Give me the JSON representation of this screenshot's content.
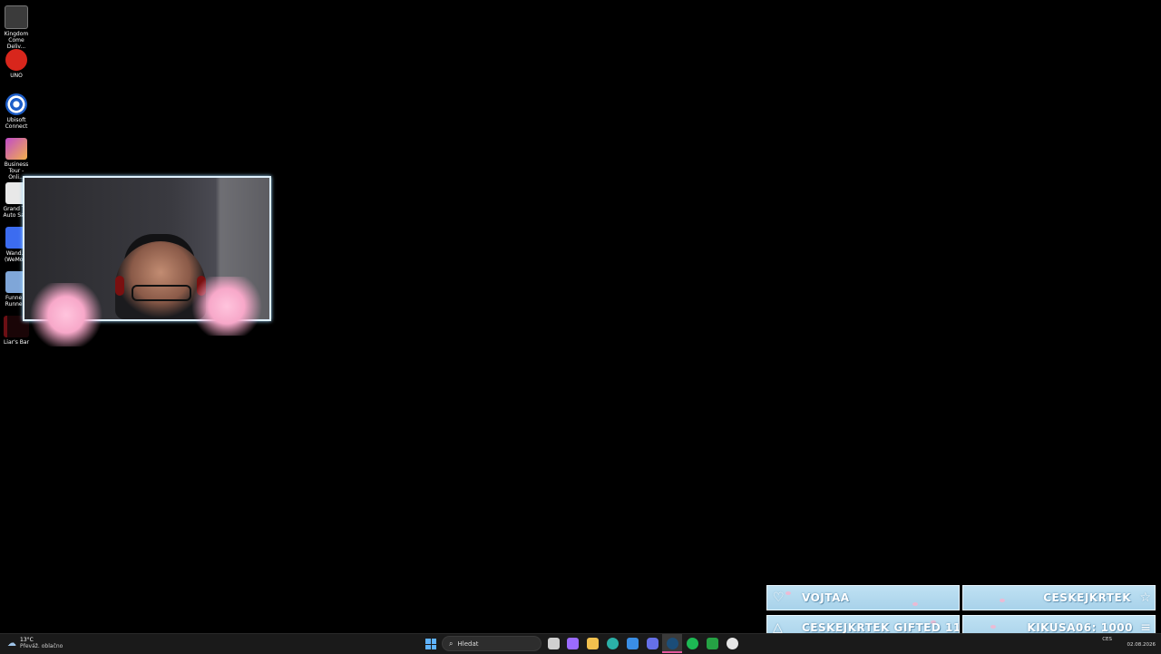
{
  "desktop_icons": [
    {
      "label": "Kingdom Come Deliv...",
      "icon": "kingdom-come-icon",
      "color": "#3b3b3b"
    },
    {
      "label": "UNO",
      "icon": "uno-icon",
      "color": "#d8261c"
    },
    {
      "label": "Ubisoft Connect",
      "icon": "ubisoft-icon",
      "color": "#1e5ec8"
    },
    {
      "label": "Business Tour - Onli...",
      "icon": "business-tour-icon",
      "color": "#c04bc9"
    },
    {
      "label": "Grand T... Auto Sa...",
      "icon": "gta-icon",
      "color": "#e8e8e8"
    },
    {
      "label": "Wand... (WeMo...",
      "icon": "wemod-icon",
      "color": "#3c6cf0"
    },
    {
      "label": "Funne... Runne...",
      "icon": "funnel-runner-icon",
      "color": "#7fa6d8"
    },
    {
      "label": "Liar's Bar",
      "icon": "liars-bar-icon",
      "color": "#6b0f14"
    }
  ],
  "alerts": {
    "follow": {
      "text": "VOJTAA",
      "icon": "heart-icon"
    },
    "subscriber": {
      "text": "CESKEJKRTEK",
      "icon": "star-icon"
    },
    "gift": {
      "text": "CESKEJKRTEK GIFTED 11",
      "icon": "gift-icon"
    },
    "bits": {
      "text": "KIKUSA06: 1000",
      "icon": "coins-icon"
    }
  },
  "taskbar": {
    "weather_temp": "13°C",
    "weather_desc": "Převáž. oblačno",
    "search_placeholder": "Hledat",
    "language": "CES",
    "date": "02.08.2026",
    "pinned_apps": [
      {
        "name": "task-view-icon",
        "color": "#cfcfcf"
      },
      {
        "name": "copilot-icon",
        "color": "#9b6bff"
      },
      {
        "name": "file-explorer-icon",
        "color": "#f2c14e"
      },
      {
        "name": "edge-icon",
        "color": "#2bb0a8"
      },
      {
        "name": "store-icon",
        "color": "#3a8ee6"
      },
      {
        "name": "discord-icon",
        "color": "#6570e8"
      },
      {
        "name": "steam-icon",
        "color": "#1b4d78"
      },
      {
        "name": "spotify-icon",
        "color": "#1db954"
      },
      {
        "name": "xbox-icon",
        "color": "#25a244"
      },
      {
        "name": "obs-icon",
        "color": "#e6e6e6"
      }
    ]
  }
}
